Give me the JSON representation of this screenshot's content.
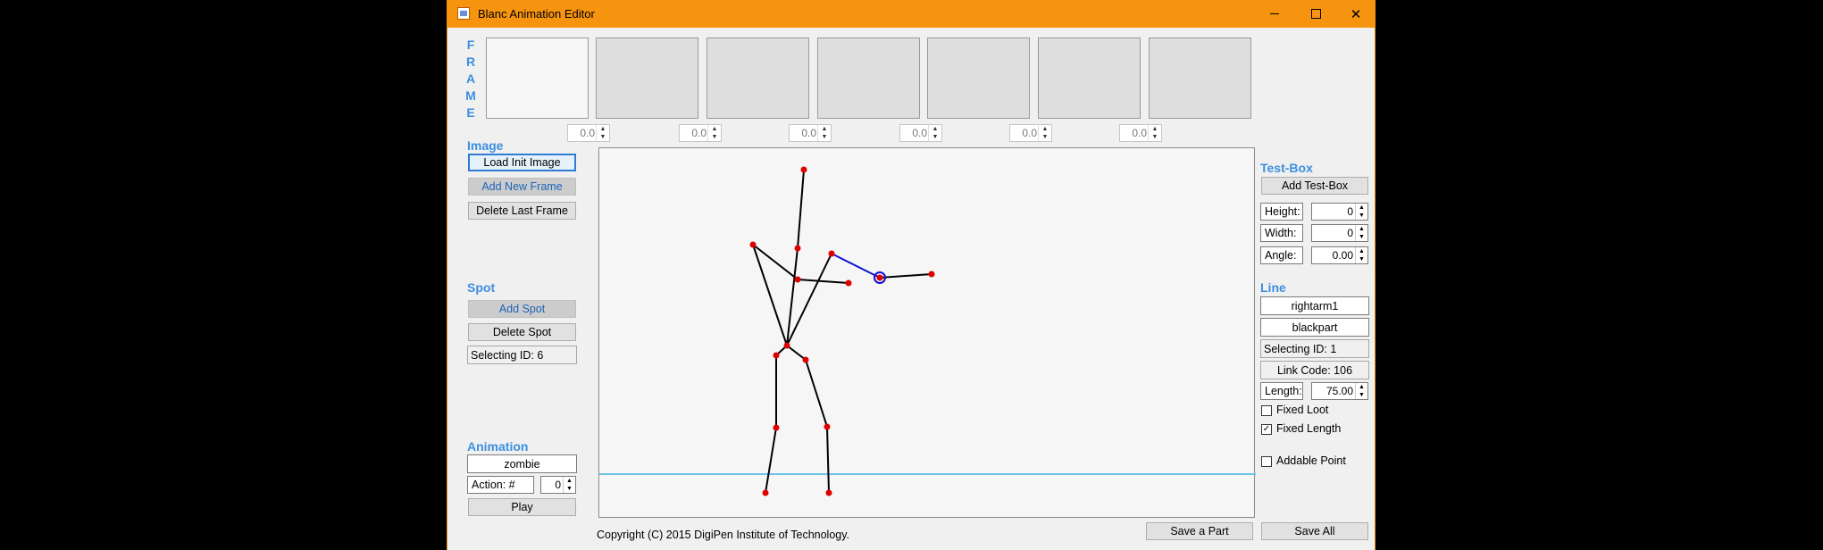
{
  "window": {
    "title": "Blanc Animation Editor",
    "accent": "#f7940f"
  },
  "titlebar": {
    "minimize_icon": "minimize-icon",
    "maximize_icon": "maximize-icon",
    "close_icon": "close-icon"
  },
  "frames": {
    "label_letters": [
      "F",
      "R",
      "A",
      "M",
      "E"
    ],
    "durations": [
      "0.0",
      "0.0",
      "0.0",
      "0.0",
      "0.0",
      "0.0"
    ]
  },
  "image": {
    "title": "Image",
    "load_init": "Load Init Image",
    "add_frame": "Add New Frame",
    "delete_frame": "Delete Last Frame"
  },
  "spot": {
    "title": "Spot",
    "add": "Add Spot",
    "delete": "Delete Spot",
    "selecting": "Selecting ID: 6"
  },
  "animation": {
    "title": "Animation",
    "name": "zombie",
    "action_label": "Action: #",
    "action_value": "0",
    "play": "Play"
  },
  "testbox": {
    "title": "Test-Box",
    "add": "Add Test-Box",
    "height_label": "Height:",
    "height_value": "0",
    "width_label": "Width:",
    "width_value": "0",
    "angle_label": "Angle:",
    "angle_value": "0.00"
  },
  "line": {
    "title": "Line",
    "name": "rightarm1",
    "part": "blackpart",
    "selecting": "Selecting ID: 1",
    "link_code": "Link Code: 106",
    "length_label": "Length:",
    "length_value": "75.00",
    "fixed_loot": "Fixed Loot",
    "fixed_loot_checked": false,
    "fixed_length": "Fixed Length",
    "fixed_length_checked": true,
    "addable_point": "Addable Point",
    "addable_point_checked": false
  },
  "footer": {
    "copyright": "Copyright (C) 2015 DigiPen Institute of Technology.",
    "save_part": "Save a Part",
    "save_all": "Save All"
  },
  "colors": {
    "joint": "#dd0000",
    "bone": "#000000",
    "selected_bone": "#1010d0",
    "ground": "#6ec3e8",
    "section": "#3d8fe0"
  }
}
